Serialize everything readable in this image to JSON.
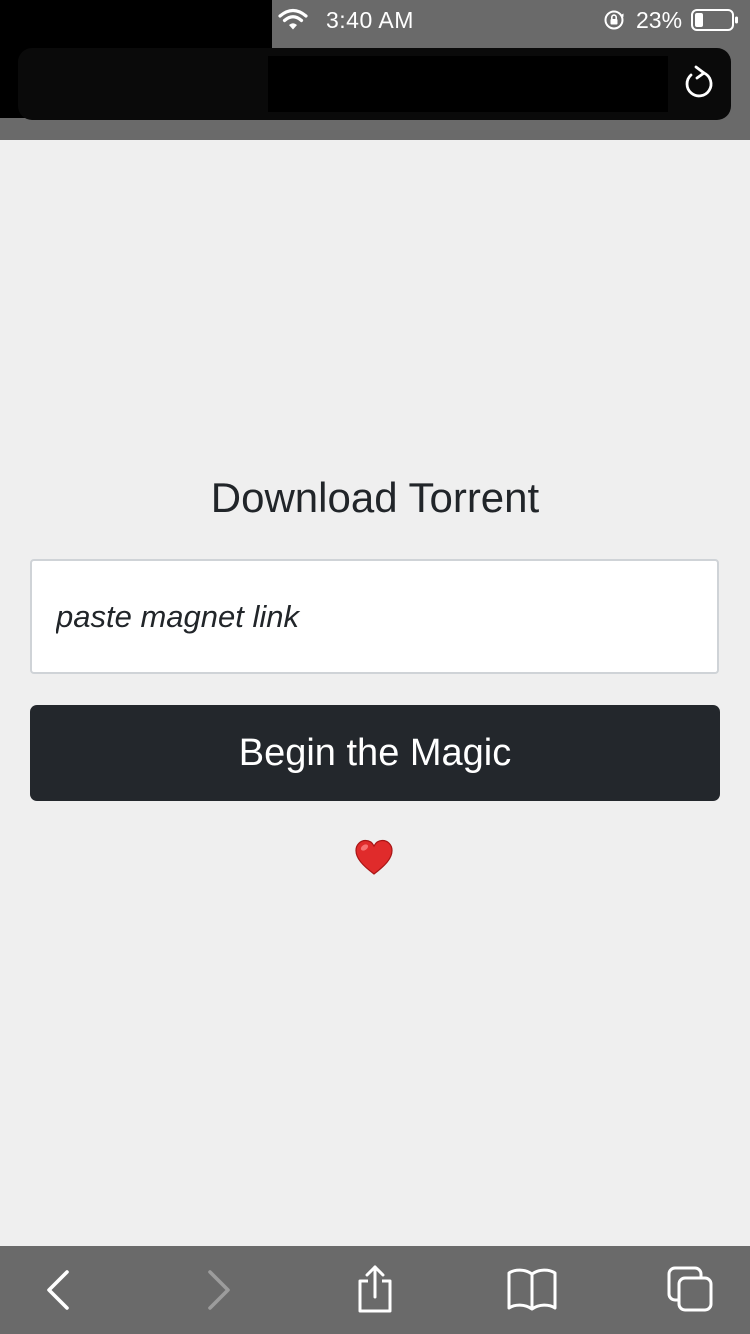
{
  "status_bar": {
    "time": "3:40 AM",
    "battery_percent": "23%",
    "battery_level": 0.23
  },
  "browser": {
    "reload_icon": "reload-icon"
  },
  "main": {
    "title": "Download Torrent",
    "magnet_input": {
      "placeholder": "paste magnet link",
      "value": ""
    },
    "submit_label": "Begin the Magic",
    "heart_icon": "heart-icon"
  },
  "toolbar": {
    "items": [
      {
        "name": "back",
        "icon": "chevron-left-icon",
        "enabled": true
      },
      {
        "name": "forward",
        "icon": "chevron-right-icon",
        "enabled": false
      },
      {
        "name": "share",
        "icon": "share-icon",
        "enabled": true
      },
      {
        "name": "bookmarks",
        "icon": "book-icon",
        "enabled": true
      },
      {
        "name": "tabs",
        "icon": "tabs-icon",
        "enabled": true
      }
    ]
  },
  "colors": {
    "chrome_bg": "#6a6a6a",
    "page_bg": "#efefef",
    "button_bg": "#23272c",
    "heart": "#e02b2b"
  }
}
